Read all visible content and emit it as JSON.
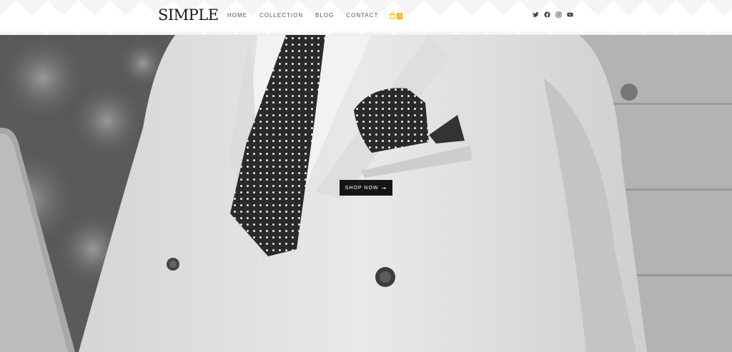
{
  "header": {
    "logo": "SIMPLE",
    "nav": [
      "HOME",
      "COLLECTION",
      "BLOG",
      "CONTACT"
    ],
    "cart_count": "0",
    "cart_icon": "shopping-bag-icon",
    "social_icons": [
      "twitter-icon",
      "facebook-icon",
      "instagram-icon",
      "youtube-icon"
    ]
  },
  "hero": {
    "button_label": "SHOP NOW",
    "button_arrow": "➞"
  },
  "colors": {
    "accent": "#f5b400",
    "button_bg": "#151515",
    "text_dark": "#1a1a1a"
  }
}
